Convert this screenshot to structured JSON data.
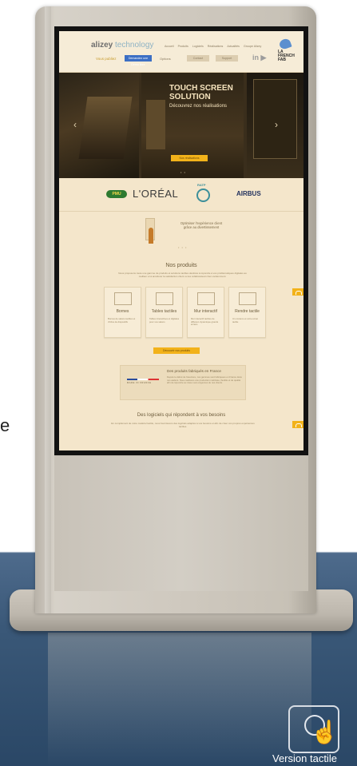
{
  "side_text": "e",
  "site": {
    "logo_brand": "alizey",
    "logo_tech": "technology",
    "nav": [
      "Accueil",
      "Produits",
      "Logiciels",
      "Réalisations",
      "Actualités",
      "Groupe Alizey"
    ],
    "header_link": "Vous publiez",
    "header_primary_button": "Demandez une Démo libre",
    "header_label": "Options",
    "header_button_1": "Contact",
    "header_button_2": "Support",
    "social_text": "in ▶",
    "fab_text": "LA FRENCH FAB"
  },
  "hero": {
    "title": "TOUCH SCREEN SOLUTION",
    "subtitle": "Découvrez nos réalisations",
    "button": "Nos réalisations",
    "prev_arrow": "‹",
    "next_arrow": "›",
    "dots": "• •"
  },
  "clients": {
    "pmu": "PMU",
    "loreal": "L'ORÉAL",
    "ratp": "RATP",
    "airbus": "AIRBUS"
  },
  "illustration_text": "Optimiser l'expérience client grâce au divertissement",
  "illustration_dots": "• • •",
  "products": {
    "title": "Nos produits",
    "description": "Nous proposons toute une gamme de produits et solutions tactiles destinés à répondre à vos problématiques digitales au meilleur et à améliorer la satisfaction client ou les collaborateurs bien évidemment.",
    "cards": [
      {
        "title": "Bornes",
        "desc": "Bornes de salons tactiles et d'infos de dispositifs"
      },
      {
        "title": "Tables tactiles",
        "desc": "Tables interactives et digitales pour vos salons"
      },
      {
        "title": "Mur interactif",
        "desc": "Mur interactif tactiles de diffusion dynamique grands écrans"
      },
      {
        "title": "Rendre tactile",
        "desc": "Un contenu et votre écran tactile"
      }
    ],
    "discover_button": "Découvrir nos produits"
  },
  "france": {
    "flag_text": "MADE IN FRANCE",
    "title": "Des produits fabriqués en France",
    "description": "Depuis le début de l'aventure, nos gammes sont fabriquées en France dans nos ateliers. Nous réalisons une production maîtrisée, flexible et de qualité afin de répondre au mieux aux exigences de nos clients."
  },
  "software": {
    "title": "Des logiciels qui répondent à vos besoins",
    "description": "En complément de notre matériel tactile, nous fournissons des logiciels adaptés à vos besoins et afin de créer vos propres expériences tactiles."
  },
  "version_label": "Version tactile"
}
